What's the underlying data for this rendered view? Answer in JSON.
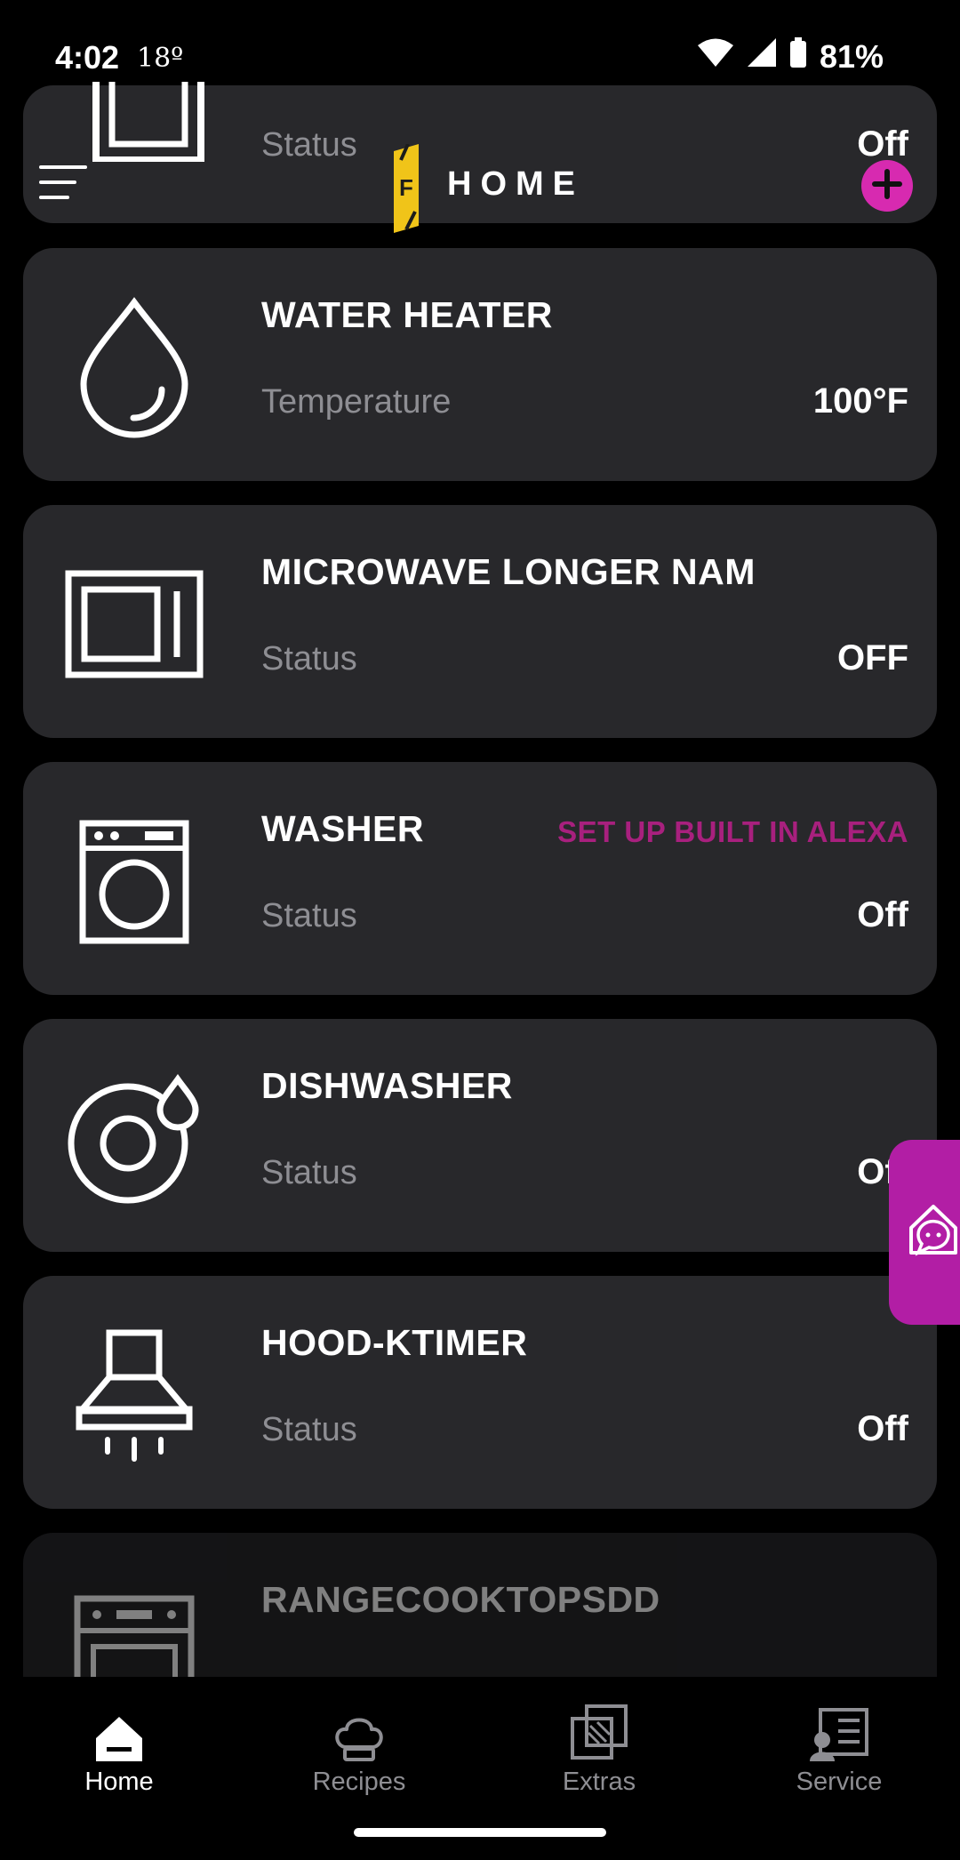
{
  "status_bar": {
    "time": "4:02",
    "temperature": "18º",
    "battery": "81%"
  },
  "header": {
    "title": "HOME",
    "logo_letter": "F"
  },
  "top_card": {
    "label": "Status",
    "value": "Off"
  },
  "appliances": [
    {
      "title": "WATER HEATER",
      "label": "Temperature",
      "value": "100°F",
      "icon": "water-drop-icon"
    },
    {
      "title": "MICROWAVE LONGER NAM",
      "label": "Status",
      "value": "OFF",
      "icon": "microwave-icon"
    },
    {
      "title": "WASHER",
      "label": "Status",
      "value": "Off",
      "icon": "washer-icon",
      "link": "SET UP BUILT IN ALEXA"
    },
    {
      "title": "DISHWASHER",
      "label": "Status",
      "value": "Off",
      "icon": "dishwasher-icon"
    },
    {
      "title": "HOOD-KTIMER",
      "label": "Status",
      "value": "Off",
      "icon": "hood-icon"
    },
    {
      "title": "RANGECOOKTOPSDD",
      "icon": "range-icon"
    }
  ],
  "nav": [
    {
      "label": "Home",
      "icon": "home-icon",
      "active": true
    },
    {
      "label": "Recipes",
      "icon": "chef-hat-icon",
      "active": false
    },
    {
      "label": "Extras",
      "icon": "extras-icon",
      "active": false
    },
    {
      "label": "Service",
      "icon": "service-icon",
      "active": false
    }
  ],
  "colors": {
    "accent": "#d72ab0",
    "link": "#a8207e",
    "card": "#28282b",
    "background": "#000000"
  }
}
